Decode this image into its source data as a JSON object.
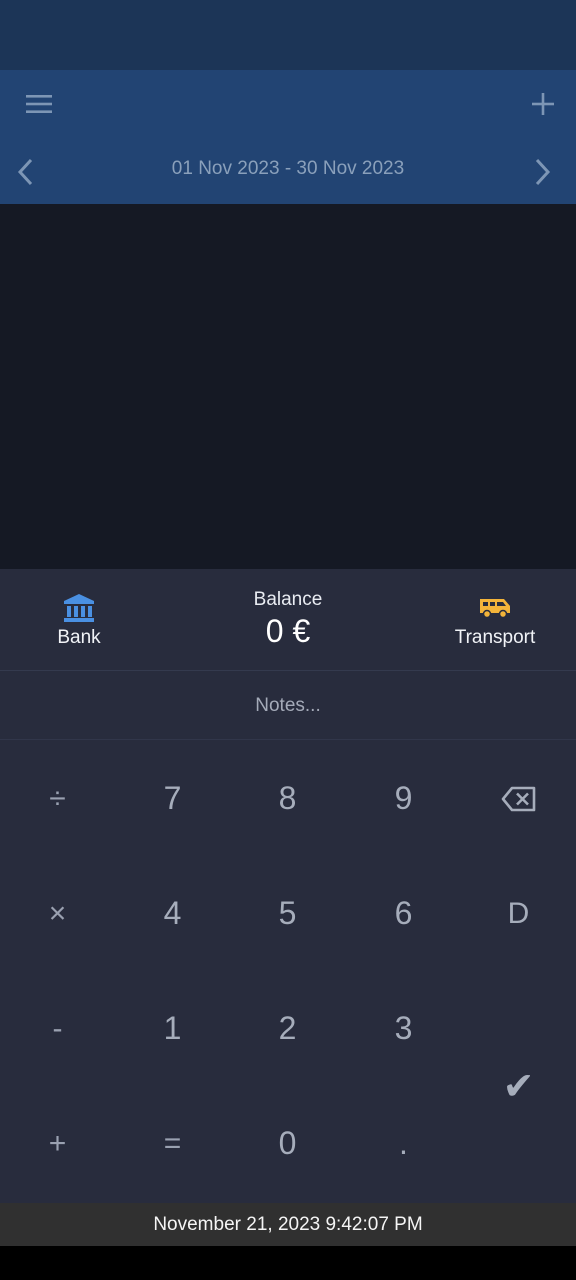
{
  "header": {
    "menu_icon": "hamburger-menu-icon",
    "add_icon": "plus-icon",
    "prev_icon": "chevron-left-icon",
    "next_icon": "chevron-right-icon",
    "period": "01 Nov 2023 - 30 Nov 2023"
  },
  "transaction": {
    "from_account": {
      "name": "Bank",
      "icon": "bank-icon",
      "color": "#4a90e2"
    },
    "to_account": {
      "name": "Transport",
      "icon": "van-icon",
      "color": "#f3b43a"
    },
    "balance_label": "Balance",
    "balance_value": "0 €",
    "notes_placeholder": "Notes..."
  },
  "keypad": {
    "divide": "÷",
    "multiply": "×",
    "minus": "-",
    "plus": "+",
    "equals": "=",
    "digits": [
      "7",
      "8",
      "9",
      "4",
      "5",
      "6",
      "1",
      "2",
      "3",
      "0"
    ],
    "decimal": ".",
    "date_key": "D",
    "backspace_icon": "backspace-icon",
    "confirm": "✔"
  },
  "footer": {
    "datetime": "November 21, 2023 9:42:07 PM"
  },
  "colors": {
    "status_bar": "#1c3557",
    "app_bar": "#224473",
    "content_bg": "#151924",
    "panel_bg": "#282c3d",
    "footer_bg": "#303030"
  }
}
